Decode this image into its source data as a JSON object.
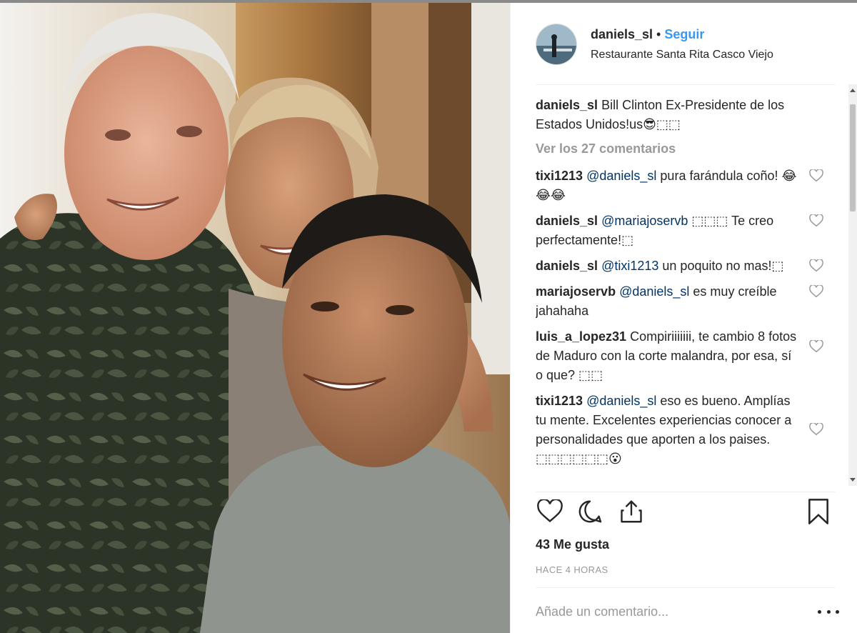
{
  "post": {
    "username": "daniels_sl",
    "separator": "•",
    "follow_label": "Seguir",
    "location": "Restaurante Santa Rita Casco Viejo"
  },
  "caption": {
    "username": "daniels_sl",
    "text": "Bill Clinton Ex-Presidente de los Estados Unidos!us😎⬚⬚"
  },
  "view_all_comments": "Ver los 27 comentarios",
  "comments": [
    {
      "username": "tixi1213",
      "mention": "@daniels_sl",
      "text": "pura farándula coño! 😂😂😂"
    },
    {
      "username": "daniels_sl",
      "mention": "@mariajoservb",
      "text": "⬚⬚⬚ Te creo perfectamente!⬚"
    },
    {
      "username": "daniels_sl",
      "mention": "@tixi1213",
      "text": "un poquito no mas!⬚"
    },
    {
      "username": "mariajoservb",
      "mention": "@daniels_sl",
      "text": "es muy creíble jahahaha"
    },
    {
      "username": "luis_a_lopez31",
      "mention": "",
      "text": "Compiriiiiiii, te cambio 8 fotos de Maduro con la corte malandra, por esa, sí o que? ⬚⬚"
    },
    {
      "username": "tixi1213",
      "mention": "@daniels_sl",
      "text": "eso es bueno. Amplías tu mente. Excelentes experiencias conocer a personalidades que aporten a los paises. ⬚⬚⬚⬚⬚⬚😮"
    }
  ],
  "actions": {
    "like_icon": "heart-outline-icon",
    "comment_icon": "speech-bubble-icon",
    "share_icon": "share-icon",
    "save_icon": "bookmark-icon"
  },
  "likes_text": "43 Me gusta",
  "time_text": "HACE 4 HORAS",
  "add_comment_placeholder": "Añade un comentario...",
  "more_icon": "ellipsis-icon",
  "colors": {
    "link_blue": "#3897f0",
    "mention_blue": "#003569",
    "muted": "#999999",
    "text": "#262626"
  }
}
